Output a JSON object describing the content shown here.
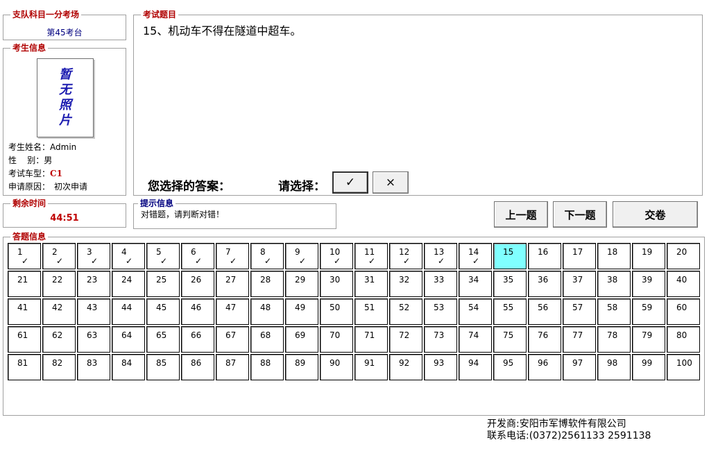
{
  "venue": {
    "title": "支队科目一分考场",
    "name": "第45考台"
  },
  "candidate": {
    "title": "考生信息",
    "photo_text": [
      "暂",
      "无",
      "照",
      "片"
    ],
    "fields": [
      {
        "label": "考生姓名：",
        "value": "Admin"
      },
      {
        "label": "性    别：",
        "value": "男"
      },
      {
        "label": "考试车型：",
        "value": "C1"
      },
      {
        "label": "申请原因：",
        "value": "初次申请"
      }
    ]
  },
  "question": {
    "title": "考试题目",
    "text": "15、机动车不得在隧道中超车。",
    "answer_label": "您选择的答案：",
    "select_label": "请选择：",
    "options": [
      {
        "label": "✓",
        "selected": true
      },
      {
        "label": "×",
        "selected": false
      }
    ]
  },
  "timer": {
    "title": "剩余时间",
    "value": "44:51"
  },
  "hint": {
    "title": "提示信息",
    "text": "对错题，请判断对错！"
  },
  "nav": {
    "prev": "上一题",
    "next": "下一题",
    "submit": "交卷"
  },
  "answers": {
    "title": "答题信息",
    "current": 15,
    "total": 100,
    "answered_mark": "✓",
    "answered": [
      1,
      2,
      3,
      4,
      5,
      6,
      7,
      8,
      9,
      10,
      11,
      12,
      13,
      14
    ],
    "current_color": "#80ffff"
  },
  "footer": {
    "developer": "开发商:安阳市军博软件有限公司",
    "phone": "联系电话:(0372)2561133 2591138"
  }
}
